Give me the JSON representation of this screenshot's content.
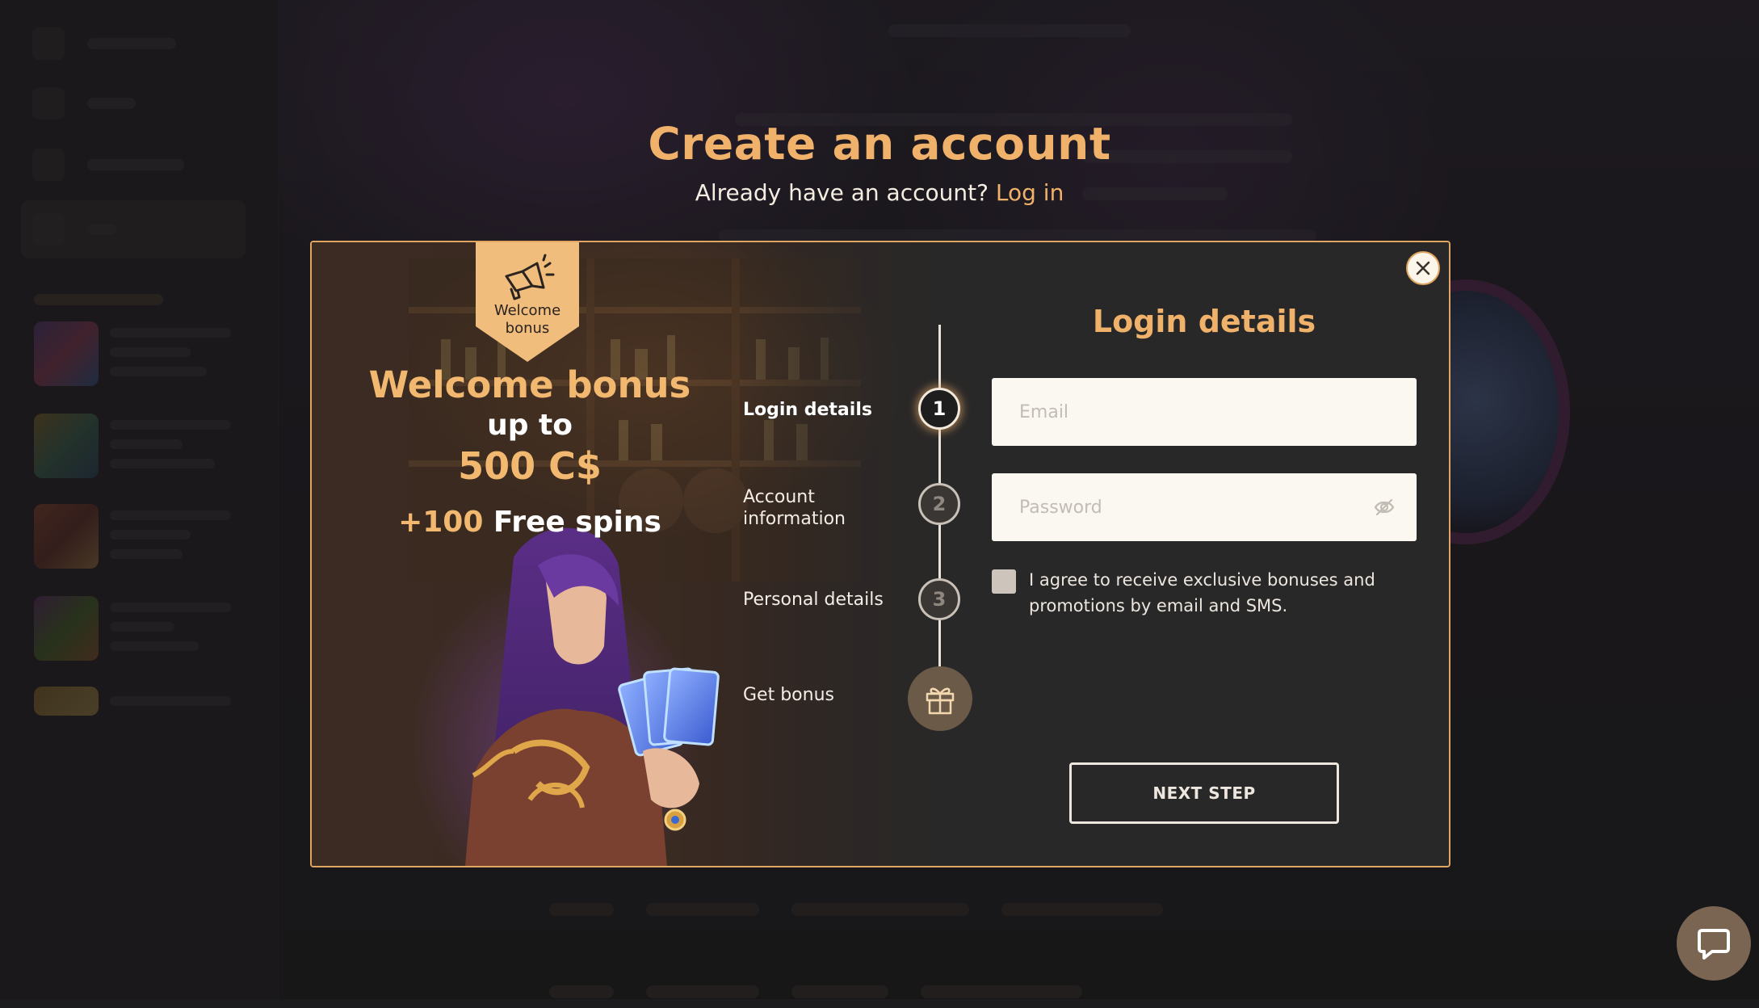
{
  "header": {
    "title": "Create an account",
    "subtitle_prefix": "Already have an account?",
    "login_link": "Log in"
  },
  "promo": {
    "badge_label": "Welcome bonus",
    "title": "Welcome bonus",
    "up_to": "up to",
    "amount": "500 C$",
    "spins_number": "+100",
    "spins_text": "Free spins"
  },
  "steps": [
    {
      "label": "Login details",
      "number": "1",
      "state": "active"
    },
    {
      "label": "Account information",
      "number": "2",
      "state": "pending"
    },
    {
      "label": "Personal details",
      "number": "3",
      "state": "pending"
    },
    {
      "label": "Get bonus",
      "icon": "gift-icon",
      "state": "pending"
    }
  ],
  "form": {
    "title": "Login details",
    "email_placeholder": "Email",
    "password_placeholder": "Password",
    "consent_text": "I agree to receive exclusive bonuses and promotions by email and SMS.",
    "next_button": "NEXT STEP"
  },
  "icons": {
    "close": "close-icon",
    "eye": "eye-off-icon",
    "chat": "chat-icon",
    "badge": "megaphone-icon"
  },
  "colors": {
    "accent": "#f0b16a",
    "modal_bg": "#292828",
    "border": "#e0a561"
  }
}
